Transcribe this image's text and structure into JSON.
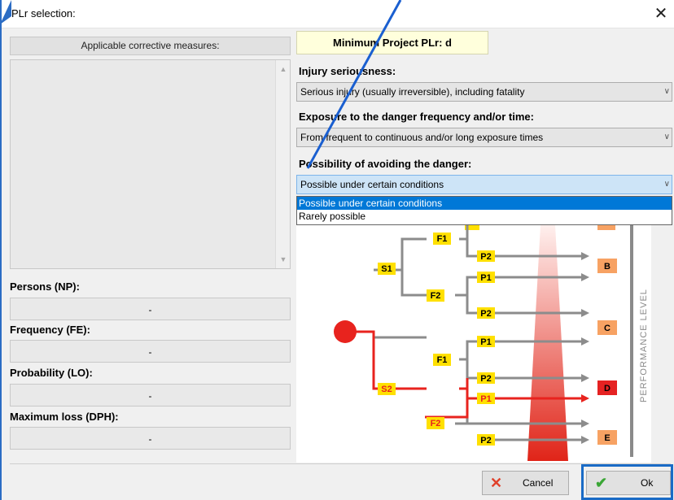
{
  "window": {
    "title": "PLr selection:"
  },
  "left": {
    "header": "Applicable corrective measures:",
    "fields": [
      {
        "label": "Persons (NP):",
        "value": "-"
      },
      {
        "label": "Frequency (FE):",
        "value": "-"
      },
      {
        "label": "Probability (LO):",
        "value": "-"
      },
      {
        "label": "Maximum loss (DPH):",
        "value": "-"
      }
    ]
  },
  "right": {
    "min_project": "Minimum Project PLr: d",
    "injury_label": "Injury seriousness:",
    "injury_value": "Serious injury (usually irreversible), including fatality",
    "exposure_label": "Exposure to the danger frequency and/or time:",
    "exposure_value": "From frequent to continuous and/or long exposure times",
    "avoid_label": "Possibility of avoiding the danger:",
    "avoid_value": "Possible under certain conditions",
    "avoid_options": [
      "Possible under certain conditions",
      "Rarely possible"
    ]
  },
  "diagram": {
    "s_nodes": [
      "S1",
      "S2"
    ],
    "f_nodes": [
      "F1",
      "F2",
      "F1",
      "F2"
    ],
    "p_nodes": [
      "P2",
      "P1",
      "P2",
      "P1",
      "P2",
      "P1",
      "P2"
    ],
    "levels": [
      "B",
      "C",
      "D",
      "E"
    ],
    "axis_label": "PERFORMANCE LEVEL",
    "colors": {
      "highlight": "#e8231e",
      "node": "#ffe000",
      "level": "#f7a263",
      "selected_level": "#e52222"
    }
  },
  "buttons": {
    "cancel": "Cancel",
    "ok": "Ok"
  },
  "icons": {
    "cancel": "x-icon",
    "ok": "check-icon",
    "close": "close-icon"
  }
}
